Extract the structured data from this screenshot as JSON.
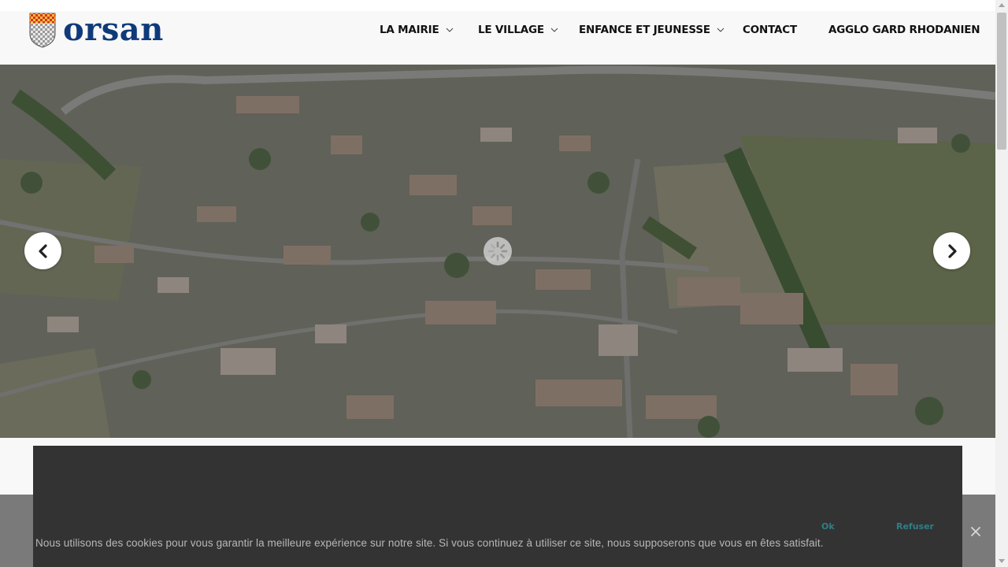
{
  "site": {
    "logo_text": "orsan"
  },
  "nav": {
    "items": [
      {
        "label": "LA MAIRIE",
        "has_dropdown": true
      },
      {
        "label": "LE VILLAGE",
        "has_dropdown": true
      },
      {
        "label": "ENFANCE ET JEUNESSE",
        "has_dropdown": true
      },
      {
        "label": "CONTACT",
        "has_dropdown": false
      },
      {
        "label": "AGGLO GARD RHODANIEN",
        "has_dropdown": false
      }
    ]
  },
  "slider": {
    "prev_icon": "chevron-left-icon",
    "next_icon": "chevron-right-icon",
    "loading_icon": "spinner-icon"
  },
  "cookie_banner": {
    "message": "Nous utilisons des cookies pour vous garantir la meilleure expérience sur notre site. Si vous continuez à utiliser ce site, nous supposerons que vous en êtes satisfait.",
    "ok_label": "Ok",
    "refuse_label": "Refuser",
    "close_icon": "close-icon"
  },
  "colors": {
    "logo_blue": "#0f3a7a",
    "cookie_button": "#2f7f86",
    "panel_dark": "#333333"
  }
}
